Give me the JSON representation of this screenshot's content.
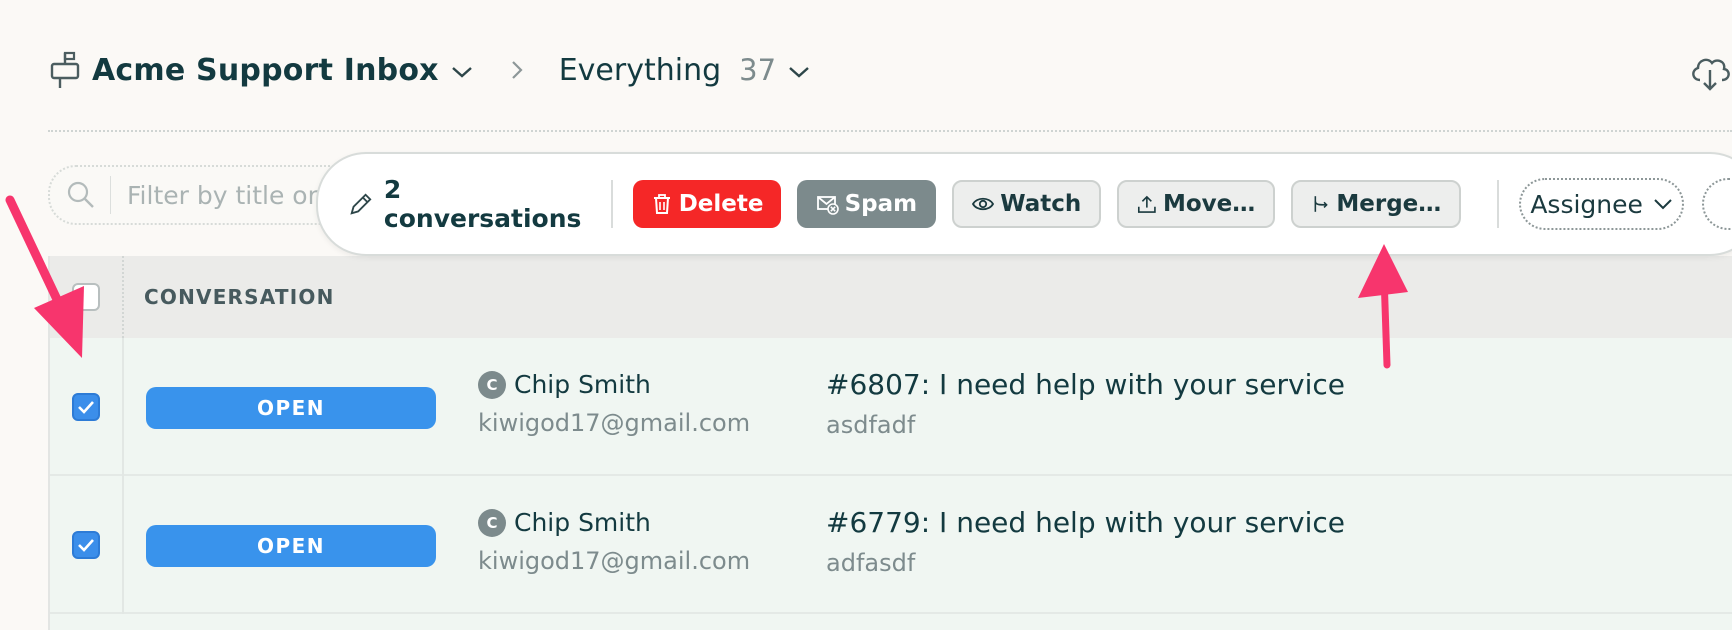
{
  "header": {
    "inbox_name": "Acme Support Inbox",
    "view_name": "Everything",
    "view_count": "37"
  },
  "filter": {
    "placeholder": "Filter by title or a"
  },
  "bulk_actions": {
    "selection_label": "2 conversations",
    "delete_label": "Delete",
    "spam_label": "Spam",
    "watch_label": "Watch",
    "move_label": "Move…",
    "merge_label": "Merge…",
    "assignee_label": "Assignee"
  },
  "table": {
    "column_header": "CONVERSATION",
    "rows": [
      {
        "checked": true,
        "status": "OPEN",
        "avatar_initial": "C",
        "contact_name": "Chip Smith",
        "contact_email": "kiwigod17@gmail.com",
        "subject": "#6807: I need help with your service",
        "preview": "asdfadf"
      },
      {
        "checked": true,
        "status": "OPEN",
        "avatar_initial": "C",
        "contact_name": "Chip Smith",
        "contact_email": "kiwigod17@gmail.com",
        "subject": "#6779: I need help with your service",
        "preview": "adfasdf"
      }
    ]
  },
  "colors": {
    "delete": "#f52727",
    "spam": "#7c8a8c",
    "status_open": "#3993ec",
    "checkbox_checked": "#3b8eea",
    "annotation_arrow": "#f7356d"
  }
}
